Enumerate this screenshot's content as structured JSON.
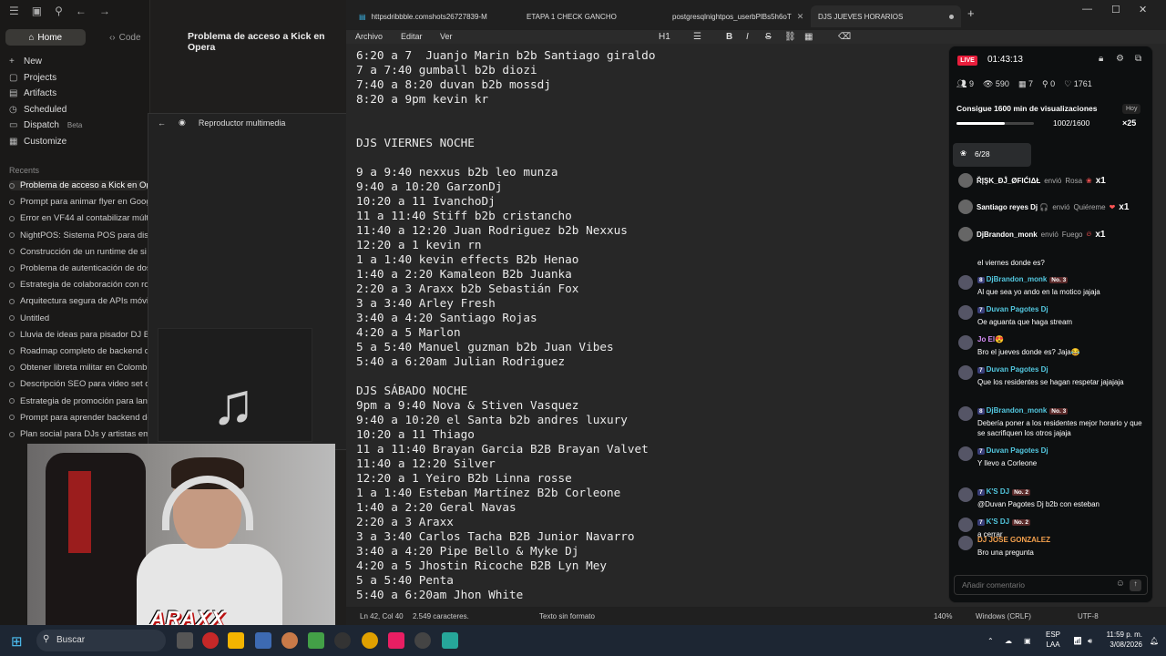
{
  "left_app": {
    "home": "Home",
    "code": "Code",
    "nav": [
      {
        "label": "New",
        "icon": "+"
      },
      {
        "label": "Projects",
        "icon": "▢"
      },
      {
        "label": "Artifacts",
        "icon": "▤"
      },
      {
        "label": "Scheduled",
        "icon": "◷"
      },
      {
        "label": "Dispatch",
        "icon": "▭",
        "badge": "Beta"
      },
      {
        "label": "Customize",
        "icon": "▦"
      }
    ],
    "recents_header": "Recents",
    "recents": [
      "Problema de acceso a Kick en Ope",
      "Prompt para animar flyer en Goog",
      "Error en VF44 al contabilizar múlt",
      "NightPOS: Sistema POS para disco",
      "Construcción de un runtime de si",
      "Problema de autenticación de dos",
      "Estrategia de colaboración con rol",
      "Arquitectura segura de APIs móvi",
      "Untitled",
      "Lluvia de ideas para pisador DJ B2",
      "Roadmap completo de backend de",
      "Obtener libreta militar en Colomb",
      "Descripción SEO para video set d",
      "Estrategia de promoción para lanz",
      "Prompt para aprender backend de",
      "Plan social para DJs y artistas eme"
    ],
    "conversation_title": "Problema de acceso a Kick en Opera",
    "media_player_title": "Reproductor multimedia",
    "overlay_logo": "ARAXX"
  },
  "notepad": {
    "tabs": [
      {
        "label": "httpsdribbble.comshots26727839-M",
        "icon": "notepad-icon"
      },
      {
        "label": "ETAPA 1 CHECK GANCHO"
      },
      {
        "label": "postgresqlnightpos_userbPlBs5h6oT"
      },
      {
        "label": "DJS JUEVES HORARIOS",
        "active": true
      }
    ],
    "menu": [
      "Archivo",
      "Editar",
      "Ver"
    ],
    "heading_tool": "H1",
    "lines": [
      "6:20 a 7  Juanjo Marin b2b Santiago giraldo",
      "7 a 7:40 gumball b2b diozi",
      "7:40 a 8:20 duvan b2b mossdj",
      "8:20 a 9pm kevin kr",
      "",
      "",
      "DJS VIERNES NOCHE",
      "",
      "9 a 9:40 nexxus b2b leo munza",
      "9:40 a 10:20 GarzonDj",
      "10:20 a 11 IvanchoDj",
      "11 a 11:40 Stiff b2b cristancho",
      "11:40 a 12:20 Juan Rodriguez b2b Nexxus",
      "12:20 a 1 kevin rn",
      "1 a 1:40 kevin effects B2b Henao",
      "1:40 a 2:20 Kamaleon B2b Juanka",
      "2:20 a 3 Araxx b2b Sebastián Fox",
      "3 a 3:40 Arley Fresh",
      "3:40 a 4:20 Santiago Rojas",
      "4:20 a 5 Marlon",
      "5 a 5:40 Manuel guzman b2b Juan Vibes",
      "5:40 a 6:20am Julian Rodriguez",
      "",
      "DJS SÁBADO NOCHE",
      "9pm a 9:40 Nova & Stiven Vasquez",
      "9:40 a 10:20 el Santa b2b andres luxury",
      "10:20 a 11 Thiago",
      "11 a 11:40 Brayan Garcia B2B Brayan Valvet",
      "11:40 a 12:20 Silver",
      "12:20 a 1 Yeiro B2b Linna rosse",
      "1 a 1:40 Esteban Martínez B2b Corleone",
      "1:40 a 2:20 Geral Navas",
      "2:20 a 3 Araxx",
      "3 a 3:40 Carlos Tacha B2B Junior Navarro",
      "3:40 a 4:20 Pipe Bello & Myke Dj",
      "4:20 a 5 Jhostin Ricoche B2B Lyn Mey",
      "5 a 5:40 Penta",
      "5:40 a 6:20am Jhon White"
    ],
    "status": {
      "position": "Ln 42, Col 40",
      "chars": "2.549 caracteres.",
      "format": "Texto sin formato",
      "zoom": "140%",
      "eol": "Windows (CRLF)",
      "encoding": "UTF-8"
    }
  },
  "kick": {
    "live": "LIVE",
    "timer": "01:43:13",
    "stats": [
      {
        "icon": "users-icon",
        "value": "9"
      },
      {
        "icon": "eye-icon",
        "value": "590"
      },
      {
        "icon": "calendar-icon",
        "value": "7"
      },
      {
        "icon": "chain-icon",
        "value": "0"
      },
      {
        "icon": "heart-icon",
        "value": "1761"
      }
    ],
    "goal": "Consigue 1600 min de visualizaciones",
    "goal_badge": "Hoy",
    "goal_progress": "1002/1600",
    "goal_fraction": 0.626,
    "goal_multiplier": "×25",
    "gift_counter": "6/28",
    "gifts": [
      {
        "user": "ŘĮŞK_ĐĴ_ØFIĆIΔŁ",
        "verb": "envió",
        "gift": "Rosa",
        "mult": "x1"
      },
      {
        "user": "Santiago reyes Dj 🎧",
        "verb": "envió",
        "gift": "Quiéreme",
        "mult": "x1"
      },
      {
        "user": "DjBrandon_monk",
        "verb": "envió",
        "gift": "Fuego",
        "mult": "x1"
      }
    ],
    "messages": [
      {
        "user": "",
        "badges": [],
        "text": "el viernes donde es?",
        "color": "#ffffff"
      },
      {
        "user": "DjBrandon_monk",
        "badges": [
          "8"
        ],
        "tag": "No. 3",
        "text": "Al que sea yo ando en la motico jajaja",
        "color": "#53c8e0"
      },
      {
        "user": "Duvan Pagotes Dj",
        "badges": [
          "7"
        ],
        "text": "Oe aguanta que haga stream",
        "color": "#53c8e0"
      },
      {
        "user": "Jo El😍",
        "badges": [],
        "text": "Bro el jueves donde es? Jaja😂",
        "color": "#d58df5"
      },
      {
        "user": "Duvan Pagotes Dj",
        "badges": [
          "7"
        ],
        "text": "Que los residentes se hagan respetar jajajaja",
        "color": "#53c8e0"
      },
      {
        "user": "DjBrandon_monk",
        "badges": [
          "8"
        ],
        "tag": "No. 3",
        "text": "Debería poner a los residentes mejor horario y que se sacrifiquen los otros jajaja",
        "color": "#53c8e0"
      },
      {
        "user": "Duvan Pagotes Dj",
        "badges": [
          "7"
        ],
        "text": "Y llevo a Corleone",
        "color": "#53c8e0"
      },
      {
        "user": "K'S DJ",
        "badges": [
          "7"
        ],
        "tag": "No. 2",
        "text": "@Duvan Pagotes Dj b2b con esteban",
        "color": "#53c8e0"
      },
      {
        "user": "K'S DJ",
        "badges": [
          "7"
        ],
        "tag": "No. 2",
        "text": "a cerrar",
        "color": "#53c8e0"
      },
      {
        "user": "DJ JOSE GONZALEZ",
        "badges": [],
        "text": "Bro una pregunta",
        "color": "#f5a14d"
      }
    ],
    "comment_placeholder": "Añadir comentario"
  },
  "taskbar": {
    "search": "Buscar",
    "lang": "ESP",
    "lang2": "LAA",
    "time": "11:59 p. m.",
    "date": "3/08/2026"
  }
}
